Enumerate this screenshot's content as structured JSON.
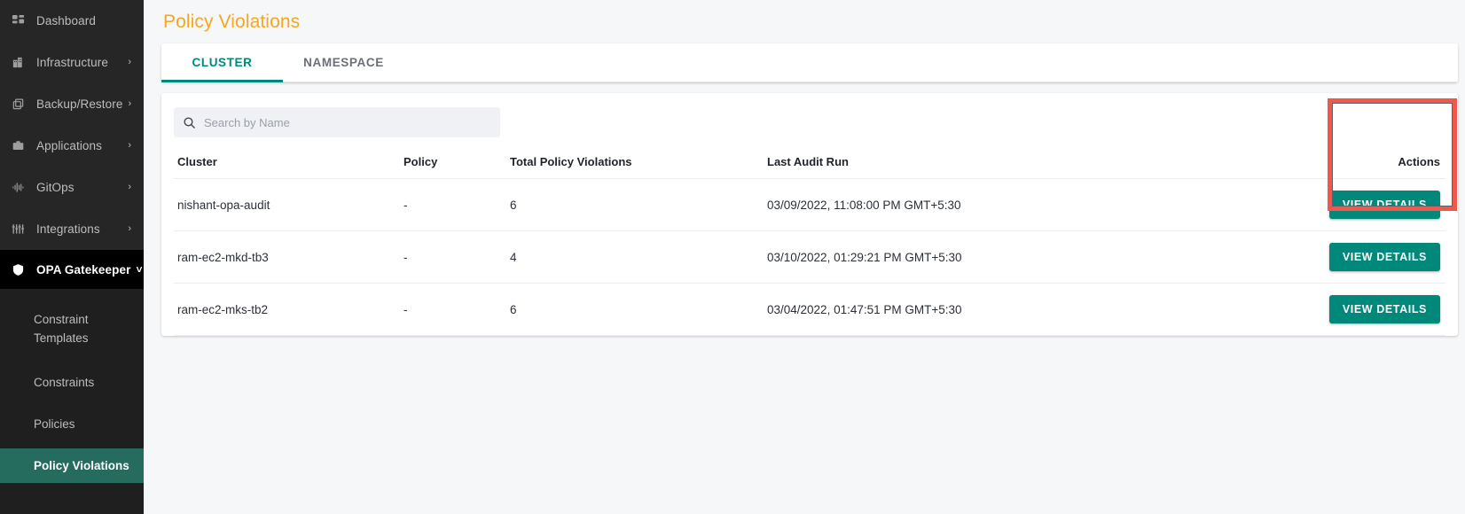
{
  "sidebar": {
    "items": [
      {
        "label": "Dashboard",
        "icon": "dashboard-grid-icon",
        "expandable": false
      },
      {
        "label": "Infrastructure",
        "icon": "building-icon",
        "expandable": true,
        "chevron": "›"
      },
      {
        "label": "Backup/Restore",
        "icon": "layers-copy-icon",
        "expandable": true,
        "chevron": "›"
      },
      {
        "label": "Applications",
        "icon": "briefcase-icon",
        "expandable": true,
        "chevron": "›"
      },
      {
        "label": "GitOps",
        "icon": "waveform-icon",
        "expandable": true,
        "chevron": "›"
      },
      {
        "label": "Integrations",
        "icon": "sliders-icon",
        "expandable": true,
        "chevron": "›"
      }
    ],
    "group": {
      "label": "OPA Gatekeeper",
      "icon": "shield-icon",
      "chevron": "˅",
      "sub_items": [
        {
          "label": "Constraint Templates",
          "active": false
        },
        {
          "label": "Constraints",
          "active": false
        },
        {
          "label": "Policies",
          "active": false
        },
        {
          "label": "Policy Violations",
          "active": true
        }
      ]
    }
  },
  "header": {
    "title": "Policy Violations"
  },
  "tabs": [
    {
      "label": "CLUSTER",
      "active": true
    },
    {
      "label": "NAMESPACE",
      "active": false
    }
  ],
  "search": {
    "placeholder": "Search by Name",
    "value": "",
    "icon": "search-icon"
  },
  "table": {
    "columns": [
      "Cluster",
      "Policy",
      "Total Policy Violations",
      "Last Audit Run",
      "Actions"
    ],
    "rows": [
      {
        "cluster": "nishant-opa-audit",
        "policy": "-",
        "total_violations": "6",
        "last_audit_run": "03/09/2022, 11:08:00 PM GMT+5:30",
        "action_label": "VIEW DETAILS"
      },
      {
        "cluster": "ram-ec2-mkd-tb3",
        "policy": "-",
        "total_violations": "4",
        "last_audit_run": "03/10/2022, 01:29:21 PM GMT+5:30",
        "action_label": "VIEW DETAILS"
      },
      {
        "cluster": "ram-ec2-mks-tb2",
        "policy": "-",
        "total_violations": "6",
        "last_audit_run": "03/04/2022, 01:47:51 PM GMT+5:30",
        "action_label": "VIEW DETAILS"
      }
    ]
  },
  "colors": {
    "accent_teal": "#00897b",
    "title_orange": "#f5a623",
    "highlight_red": "#f1584c",
    "sidebar_bg": "#262626",
    "sidebar_active": "#256b5e",
    "page_bg": "#f6f7f9"
  }
}
